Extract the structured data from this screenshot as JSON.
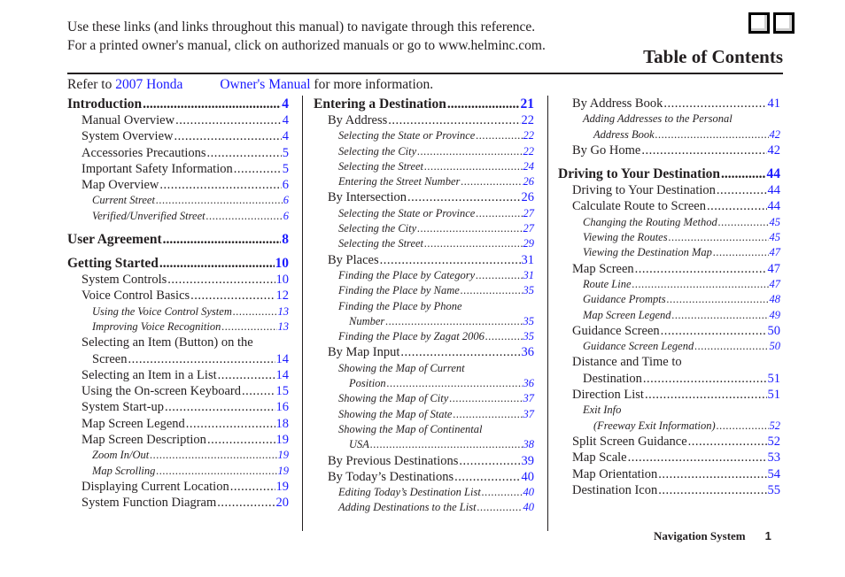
{
  "intro": {
    "line1": "Use these links (and links throughout this manual) to navigate through this reference.",
    "line2": "For a printed owner's manual, click on authorized manuals or go to www.helminc.com."
  },
  "nav_boxes": [
    "previous-page",
    "next-page"
  ],
  "title": "Table of Contents",
  "refer": {
    "prefix": "Refer to",
    "link1": "2007 Honda",
    "link2": "Owner's Manual",
    "suffix": "for more information."
  },
  "columns": [
    [
      {
        "level": "h",
        "text": "Introduction",
        "page": "4"
      },
      {
        "level": "s",
        "text": "Manual Overview",
        "page": "4"
      },
      {
        "level": "s",
        "text": "System Overview",
        "page": "4"
      },
      {
        "level": "s",
        "text": "Accessories Precautions",
        "page": "5"
      },
      {
        "level": "s",
        "text": "Important Safety Information",
        "page": "5"
      },
      {
        "level": "s",
        "text": "Map Overview",
        "page": "6"
      },
      {
        "level": "i",
        "text": "Current Street",
        "page": "6"
      },
      {
        "level": "i",
        "text": "Verified/Unverified Street",
        "page": "6"
      },
      {
        "level": "gap"
      },
      {
        "level": "h",
        "text": "User Agreement",
        "page": "8"
      },
      {
        "level": "gap"
      },
      {
        "level": "h",
        "text": "Getting Started",
        "page": "10"
      },
      {
        "level": "s",
        "text": "System Controls",
        "page": "10"
      },
      {
        "level": "s",
        "text": "Voice Control Basics",
        "page": "12"
      },
      {
        "level": "i",
        "text": "Using the Voice Control System",
        "page": "13"
      },
      {
        "level": "i",
        "text": "Improving Voice Recognition",
        "page": "13"
      },
      {
        "level": "s",
        "text": "Selecting an Item (Button) on the",
        "cont": "Screen",
        "page": "14"
      },
      {
        "level": "s",
        "text": "Selecting an Item in a List",
        "page": "14"
      },
      {
        "level": "s",
        "text": "Using the On-screen Keyboard",
        "page": "15"
      },
      {
        "level": "s",
        "text": "System Start-up",
        "page": "16"
      },
      {
        "level": "s",
        "text": "Map Screen Legend",
        "page": "18"
      },
      {
        "level": "s",
        "text": "Map Screen Description",
        "page": "19"
      },
      {
        "level": "i",
        "text": "Zoom In/Out",
        "page": "19"
      },
      {
        "level": "i",
        "text": "Map Scrolling",
        "page": "19"
      },
      {
        "level": "s",
        "text": "Displaying Current Location",
        "page": "19"
      },
      {
        "level": "s",
        "text": "System Function Diagram",
        "page": "20"
      }
    ],
    [
      {
        "level": "h",
        "text": "Entering a Destination",
        "page": "21"
      },
      {
        "level": "s",
        "text": "By Address",
        "page": "22"
      },
      {
        "level": "i",
        "text": "Selecting the State or Province",
        "page": "22"
      },
      {
        "level": "i",
        "text": "Selecting the City",
        "page": "22"
      },
      {
        "level": "i",
        "text": "Selecting the Street",
        "page": "24"
      },
      {
        "level": "i",
        "text": "Entering the Street Number",
        "page": "26"
      },
      {
        "level": "s",
        "text": "By Intersection",
        "page": "26"
      },
      {
        "level": "i",
        "text": "Selecting the State or Province",
        "page": "27"
      },
      {
        "level": "i",
        "text": "Selecting the City",
        "page": "27"
      },
      {
        "level": "i",
        "text": "Selecting the Street",
        "page": "29"
      },
      {
        "level": "s",
        "text": "By Places",
        "page": "31"
      },
      {
        "level": "i",
        "text": "Finding the Place by Category",
        "page": "31"
      },
      {
        "level": "i",
        "text": "Finding the Place by Name",
        "page": "35"
      },
      {
        "level": "i",
        "text": "Finding the Place by Phone",
        "cont": "Number",
        "page": "35"
      },
      {
        "level": "i",
        "text": "Finding the Place by Zagat 2006",
        "page": "35"
      },
      {
        "level": "s",
        "text": "By Map Input",
        "page": "36"
      },
      {
        "level": "i",
        "text": "Showing the Map of Current",
        "cont": "Position",
        "page": "36"
      },
      {
        "level": "i",
        "text": "Showing the Map of City",
        "page": "37"
      },
      {
        "level": "i",
        "text": "Showing the Map of State",
        "page": "37"
      },
      {
        "level": "i",
        "text": "Showing the Map of Continental",
        "cont": "USA",
        "page": "38"
      },
      {
        "level": "s",
        "text": "By Previous Destinations",
        "page": "39"
      },
      {
        "level": "s",
        "text": "By Today’s Destinations",
        "page": "40"
      },
      {
        "level": "i",
        "text": "Editing Today’s Destination List",
        "page": "40"
      },
      {
        "level": "i",
        "text": "Adding Destinations to the List",
        "page": "40"
      }
    ],
    [
      {
        "level": "s",
        "text": "By Address Book",
        "page": "41"
      },
      {
        "level": "i",
        "text": "Adding Addresses to the Personal",
        "cont": "Address Book",
        "page": "42"
      },
      {
        "level": "s",
        "text": "By Go Home",
        "page": "42"
      },
      {
        "level": "gap"
      },
      {
        "level": "h",
        "text": "Driving to Your Destination",
        "page": "44"
      },
      {
        "level": "s",
        "text": "Driving to Your Destination",
        "page": "44"
      },
      {
        "level": "s",
        "text": "Calculate Route to Screen",
        "page": "44"
      },
      {
        "level": "i",
        "text": "Changing the Routing Method",
        "page": "45"
      },
      {
        "level": "i",
        "text": "Viewing the Routes",
        "page": "45"
      },
      {
        "level": "i",
        "text": "Viewing the Destination Map",
        "page": "47"
      },
      {
        "level": "s",
        "text": "Map Screen",
        "page": "47"
      },
      {
        "level": "i",
        "text": "Route Line",
        "page": "47"
      },
      {
        "level": "i",
        "text": "Guidance Prompts",
        "page": "48"
      },
      {
        "level": "i",
        "text": "Map Screen Legend",
        "page": "49"
      },
      {
        "level": "s",
        "text": "Guidance Screen",
        "page": "50"
      },
      {
        "level": "i",
        "text": "Guidance Screen Legend",
        "page": "50"
      },
      {
        "level": "s",
        "text": "Distance and Time to",
        "cont": "Destination",
        "page": "51"
      },
      {
        "level": "s",
        "text": "Direction List",
        "page": "51"
      },
      {
        "level": "i",
        "text": "Exit Info",
        "cont": "(Freeway Exit Information)",
        "page": "52"
      },
      {
        "level": "s",
        "text": "Split Screen Guidance",
        "page": "52"
      },
      {
        "level": "s",
        "text": "Map Scale",
        "page": "53"
      },
      {
        "level": "s",
        "text": "Map Orientation",
        "page": "54"
      },
      {
        "level": "s",
        "text": "Destination Icon",
        "page": "55"
      }
    ]
  ],
  "footer": {
    "section": "Navigation System",
    "page_number": "1"
  },
  "colors": {
    "link": "#1a1aff",
    "text": "#231f20"
  }
}
